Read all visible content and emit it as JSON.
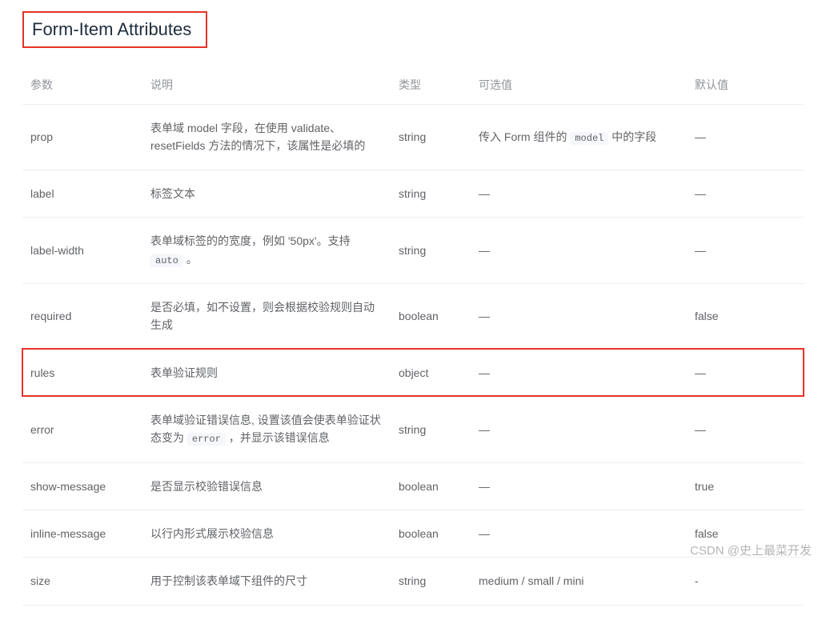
{
  "title": "Form-Item Attributes",
  "headers": {
    "param": "参数",
    "desc": "说明",
    "type": "类型",
    "options": "可选值",
    "default": "默认值"
  },
  "rows": [
    {
      "param": "prop",
      "desc": "表单域 model 字段，在使用 validate、resetFields 方法的情况下，该属性是必填的",
      "type": "string",
      "options_pre": "传入 Form 组件的 ",
      "options_code": "model",
      "options_post": " 中的字段",
      "default": "—"
    },
    {
      "param": "label",
      "desc": "标签文本",
      "type": "string",
      "options": "—",
      "default": "—"
    },
    {
      "param": "label-width",
      "desc_pre": "表单域标签的的宽度，例如 '50px'。支持 ",
      "desc_code": "auto",
      "desc_post": " 。",
      "type": "string",
      "options": "—",
      "default": "—"
    },
    {
      "param": "required",
      "desc": "是否必填，如不设置，则会根据校验规则自动生成",
      "type": "boolean",
      "options": "—",
      "default": "false"
    },
    {
      "param": "rules",
      "desc": "表单验证规则",
      "type": "object",
      "options": "—",
      "default": "—"
    },
    {
      "param": "error",
      "desc_pre": "表单域验证错误信息, 设置该值会使表单验证状态变为 ",
      "desc_code": "error",
      "desc_post": " ，并显示该错误信息",
      "type": "string",
      "options": "—",
      "default": "—"
    },
    {
      "param": "show-message",
      "desc": "是否显示校验错误信息",
      "type": "boolean",
      "options": "—",
      "default": "true"
    },
    {
      "param": "inline-message",
      "desc": "以行内形式展示校验信息",
      "type": "boolean",
      "options": "—",
      "default": "false"
    },
    {
      "param": "size",
      "desc": "用于控制该表单域下组件的尺寸",
      "type": "string",
      "options": "medium / small / mini",
      "default": "-"
    }
  ],
  "watermark": "CSDN @史上最菜开发"
}
